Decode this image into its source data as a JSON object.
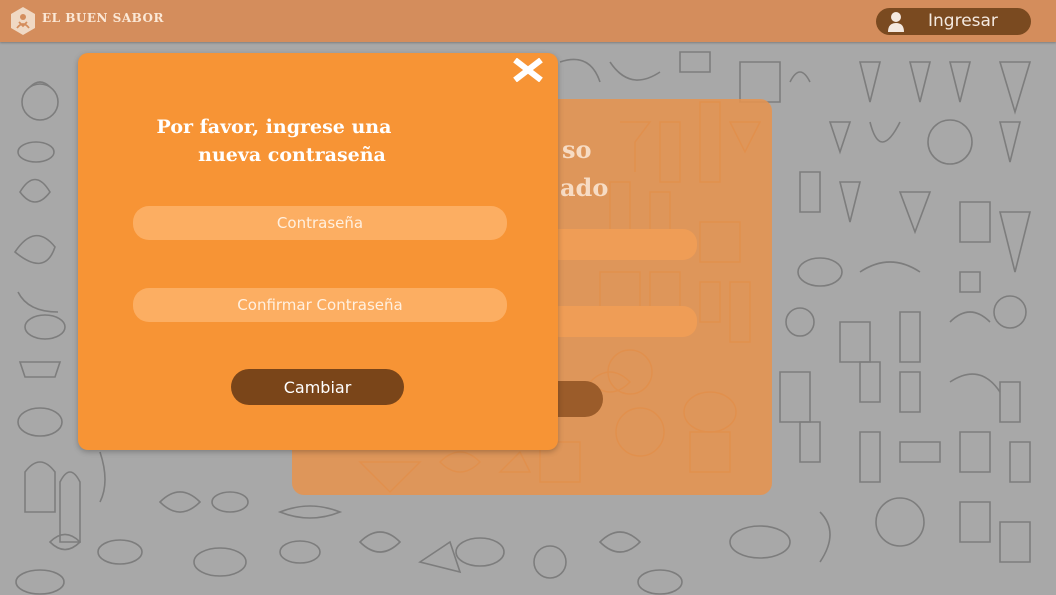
{
  "header": {
    "brand": "EL BUEN SABOR",
    "login_label": "Ingresar",
    "logo_icon": "chef-hat-icon",
    "user_icon": "user-icon"
  },
  "background_form": {
    "title_line1": "so",
    "title_line2": "ado"
  },
  "modal": {
    "title_line1": "Por favor, ingrese una",
    "title_line2": "nueva contraseña",
    "password_placeholder": "Contraseña",
    "confirm_placeholder": "Confirmar Contraseña",
    "submit_label": "Cambiar",
    "close_icon": "close-icon"
  },
  "colors": {
    "topbar": "#d48d5c",
    "modal": "#f79435",
    "button": "#7a4519",
    "background": "#a8a8a8"
  }
}
